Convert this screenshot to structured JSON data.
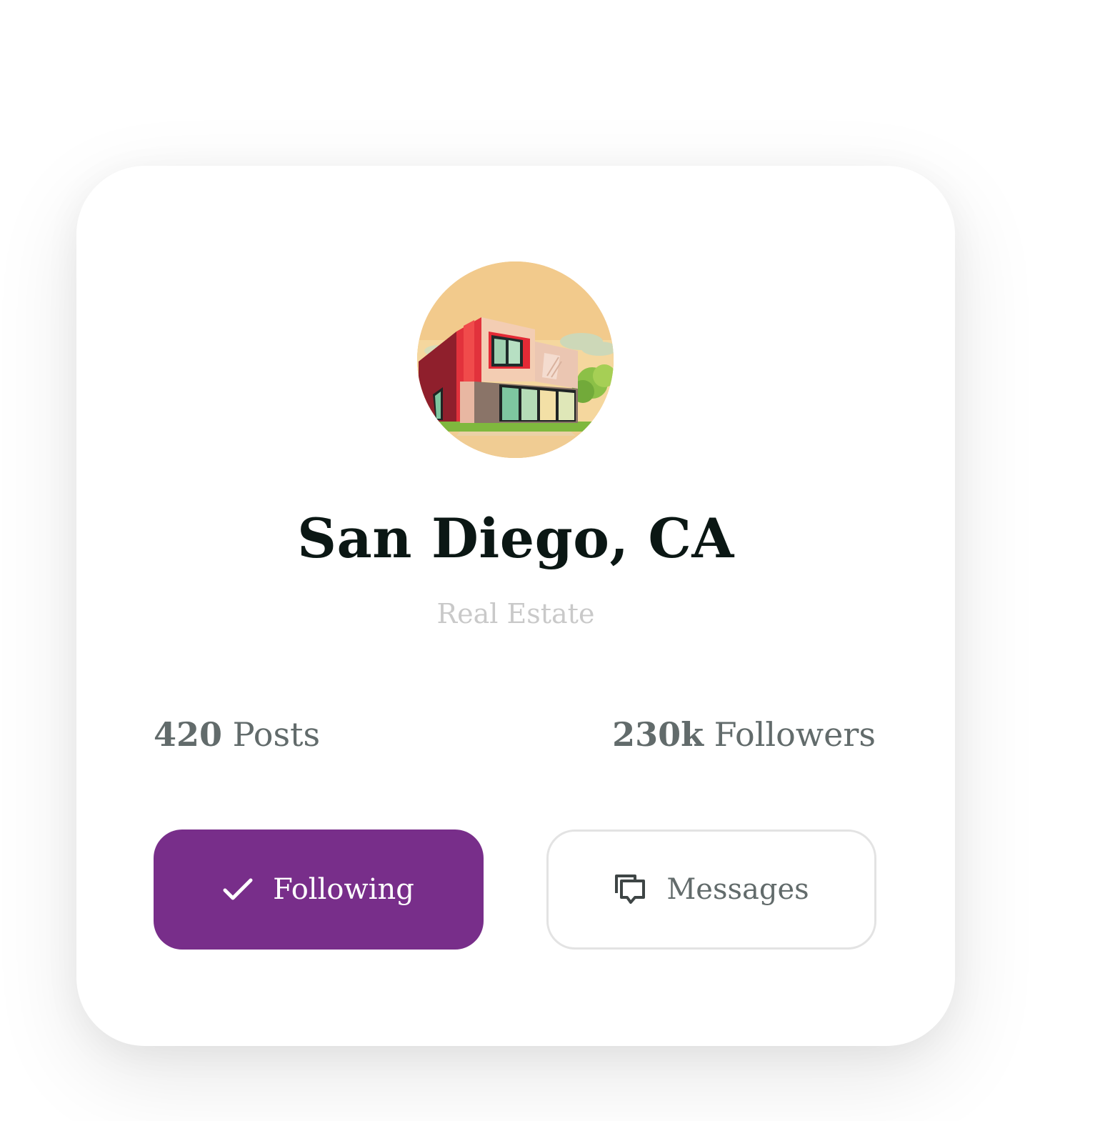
{
  "profile": {
    "name": "San Diego, CA",
    "category": "Real Estate",
    "avatar_icon": "house-illustration"
  },
  "stats": {
    "posts": {
      "value": "420",
      "label": "Posts"
    },
    "followers": {
      "value": "230k",
      "label": "Followers"
    }
  },
  "actions": {
    "following_label": "Following",
    "following_icon": "checkmark-icon",
    "messages_label": "Messages",
    "messages_icon": "chat-bubbles-icon"
  },
  "colors": {
    "accent": "#782e8a",
    "title": "#0b1714",
    "muted": "#626b6b",
    "subtitle": "#c9c9c9"
  }
}
